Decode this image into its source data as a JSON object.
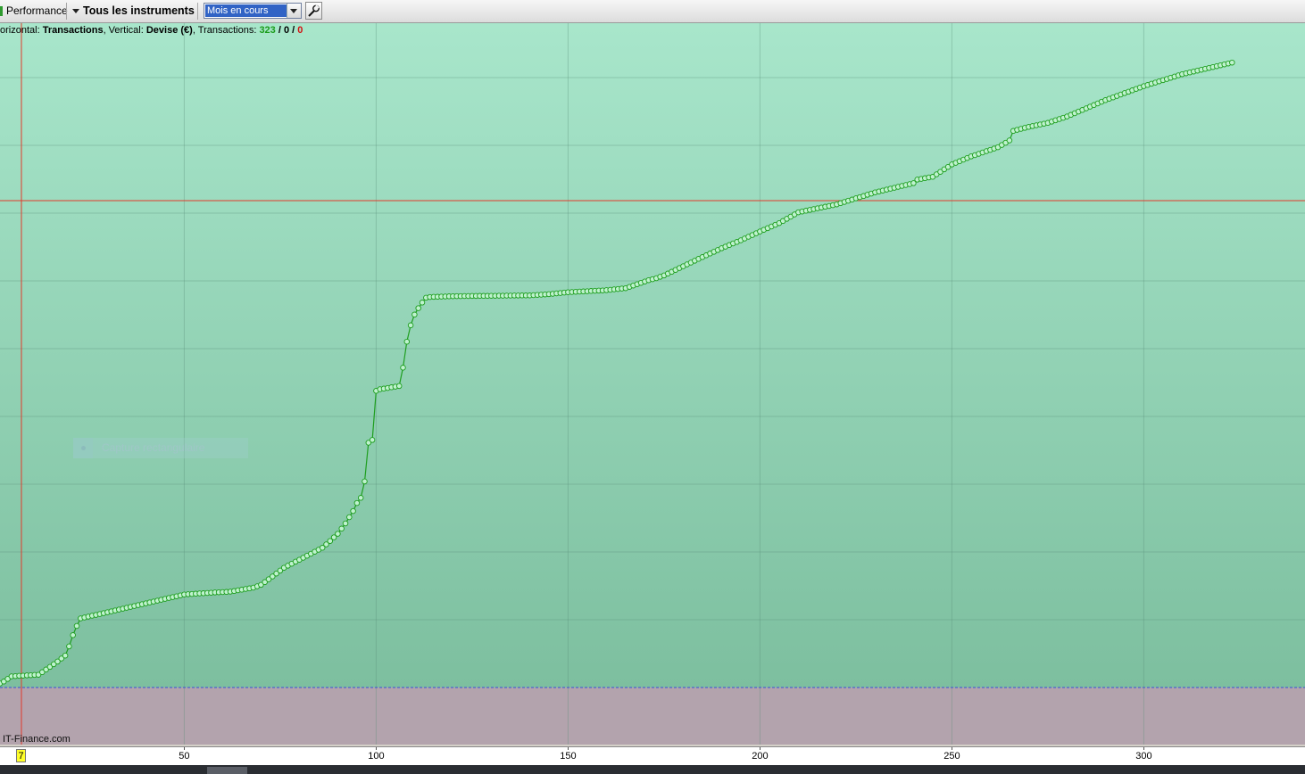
{
  "toolbar": {
    "performance_label": "Performance",
    "instruments_label": "Tous les instruments",
    "period_select_value": "Mois en cours",
    "settings_icon": "wrench-icon"
  },
  "info_line": {
    "horizontal_prefix": "orizontal: ",
    "horizontal_value": "Transactions",
    "vertical_prefix": ", Vertical: ",
    "vertical_value": "Devise (€)",
    "transactions_prefix": ", Transactions: ",
    "count_win": "323",
    "sep1": " / ",
    "count_neutral": "0",
    "sep2": " / ",
    "count_loss": "0"
  },
  "overlay": {
    "capture_label": "Capture rectangulaire"
  },
  "watermark": "IT-Finance.com",
  "cursor_value": "7",
  "colors": {
    "line": "#1e9e1e",
    "marker_fill": "#bff2cf",
    "crosshair": "#e23a2a",
    "zero_line": "#3a4fd8",
    "positive_bg_top": "#a8e6cb",
    "positive_bg_bottom": "#7dbf9f",
    "negative_bg": "#b3a3ad"
  },
  "chart_data": {
    "type": "line",
    "title": "",
    "xlabel": "",
    "ylabel": "",
    "xlim": [
      2,
      342
    ],
    "x_ticks": [
      50,
      100,
      150,
      200,
      250,
      300
    ],
    "y_axis_labels_visible": false,
    "grid": true,
    "series": [
      {
        "points_count": 323,
        "markers": "circle",
        "note_units": "y is relative equity position read from chart (0 = baseline, 100 = final level)",
        "x_keypoints": [
          1,
          2,
          3,
          5,
          12,
          14,
          17,
          19,
          20,
          21,
          22,
          23,
          50,
          58,
          62,
          65,
          68,
          70,
          73,
          76,
          78,
          81,
          86,
          88,
          90,
          92,
          94,
          95,
          96,
          97,
          98,
          99,
          100,
          101,
          106,
          107,
          108,
          109,
          110,
          111,
          112,
          113,
          114,
          120,
          130,
          140,
          145,
          150,
          160,
          165,
          168,
          171,
          173,
          175,
          180,
          185,
          190,
          195,
          200,
          205,
          210,
          220,
          230,
          240,
          241,
          245,
          250,
          255,
          262,
          265,
          266,
          270,
          275,
          280,
          290,
          300,
          310,
          323
        ],
        "y_keypoints": [
          0,
          1,
          1.5,
          2.8,
          3.2,
          4.5,
          6.5,
          8,
          10.3,
          13.1,
          15.4,
          17.3,
          23.3,
          23.8,
          24,
          24.5,
          25,
          25.7,
          27.8,
          30,
          31,
          32.5,
          35,
          36.7,
          38.5,
          41.1,
          44.2,
          46.2,
          47.5,
          51.6,
          61.3,
          62,
          74.3,
          74.7,
          75.5,
          80.1,
          86.6,
          90.7,
          93.4,
          95,
          96.4,
          97.6,
          97.8,
          98,
          98.1,
          98.2,
          98.5,
          99,
          99.5,
          100,
          101,
          102,
          102.5,
          103.2,
          105.5,
          107.8,
          110,
          112,
          114.2,
          116.3,
          119,
          121,
          124,
          126.3,
          127.2,
          127.9,
          131,
          133,
          135.3,
          137,
          139.4,
          140.4,
          141.4,
          143,
          147.1,
          150.6,
          153.6,
          156.5
        ]
      }
    ]
  }
}
